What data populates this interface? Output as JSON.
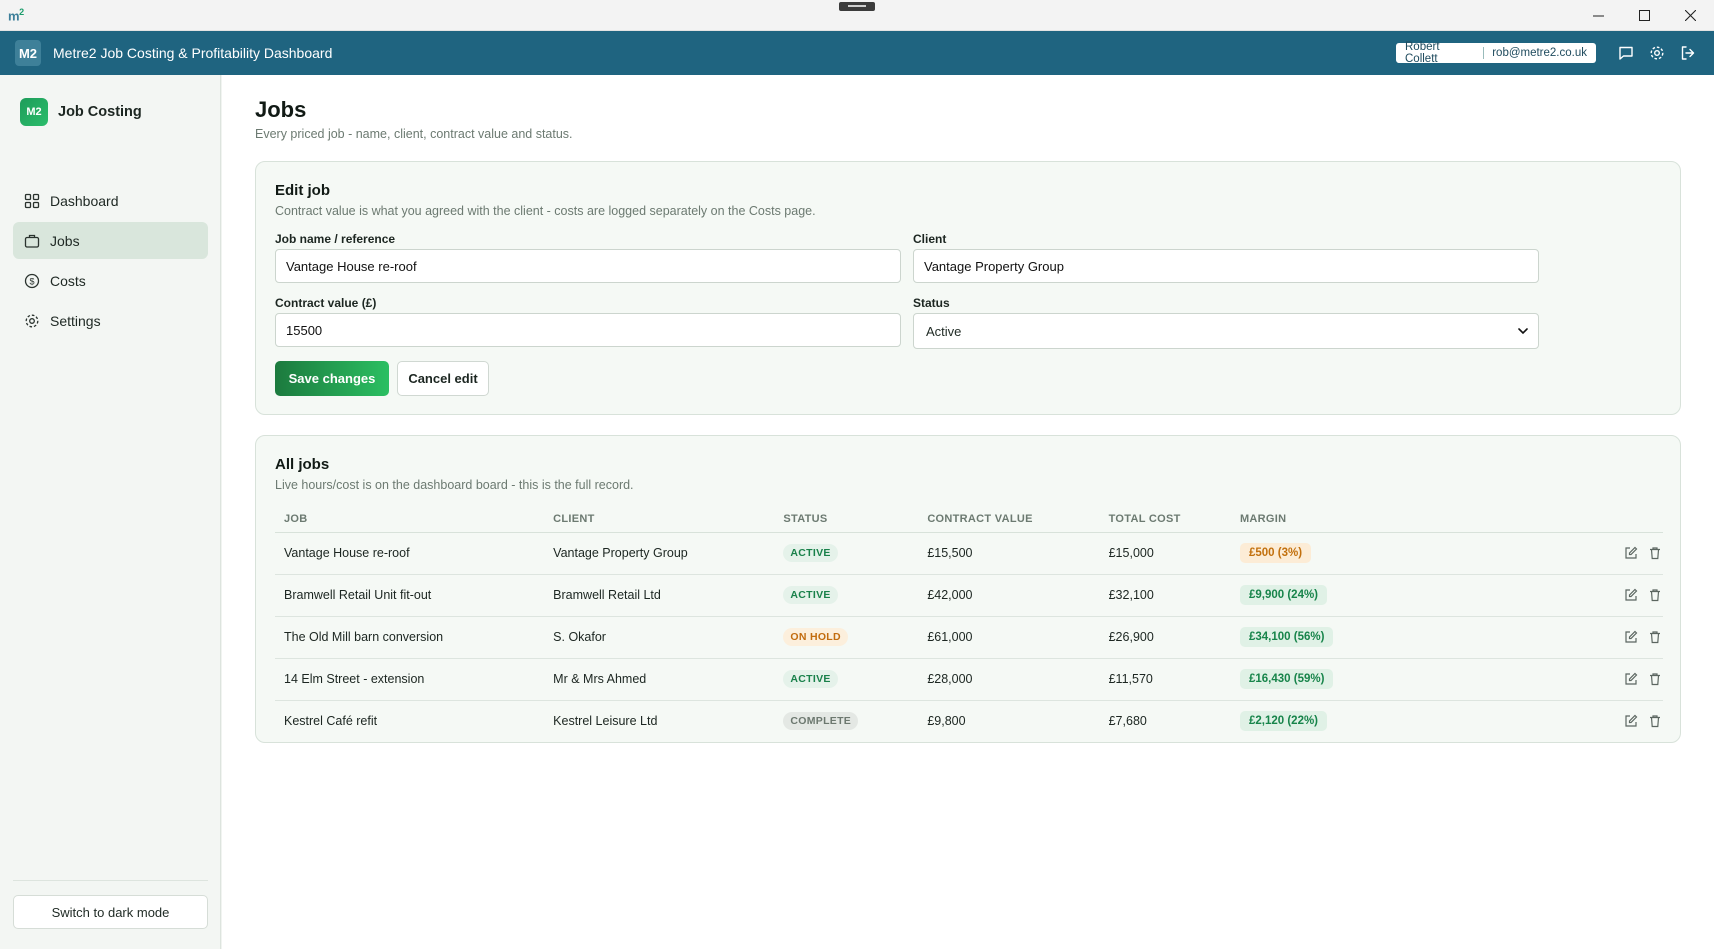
{
  "os": {
    "logo": "m",
    "logo_sup": "2"
  },
  "header": {
    "badge": "M2",
    "title": "Metre2 Job Costing & Profitability Dashboard",
    "user_name": "Robert Collett",
    "user_email": "rob@metre2.co.uk"
  },
  "sidebar": {
    "brand_badge": "M2",
    "brand_name": "Job Costing",
    "items": [
      {
        "label": "Dashboard",
        "icon": "grid-icon"
      },
      {
        "label": "Jobs",
        "icon": "briefcase-icon",
        "active": true
      },
      {
        "label": "Costs",
        "icon": "dollar-icon"
      },
      {
        "label": "Settings",
        "icon": "gear-icon"
      }
    ],
    "dark_mode_label": "Switch to dark mode"
  },
  "page": {
    "title": "Jobs",
    "subtitle": "Every priced job - name, client, contract value and status."
  },
  "edit": {
    "title": "Edit job",
    "subtitle": "Contract value is what you agreed with the client - costs are logged separately on the Costs page.",
    "job_label": "Job name / reference",
    "job_value": "Vantage House re-roof",
    "client_label": "Client",
    "client_value": "Vantage Property Group",
    "contract_label": "Contract value (£)",
    "contract_value": "15500",
    "status_label": "Status",
    "status_value": "Active",
    "save_label": "Save changes",
    "cancel_label": "Cancel edit"
  },
  "jobs": {
    "title": "All jobs",
    "subtitle": "Live hours/cost is on the dashboard board - this is the full record.",
    "columns": [
      "JOB",
      "CLIENT",
      "STATUS",
      "CONTRACT VALUE",
      "TOTAL COST",
      "MARGIN"
    ],
    "rows": [
      {
        "job": "Vantage House re-roof",
        "client": "Vantage Property Group",
        "status": "ACTIVE",
        "contract": "£15,500",
        "cost": "£15,000",
        "margin": "£500 (3%)"
      },
      {
        "job": "Bramwell Retail Unit fit-out",
        "client": "Bramwell Retail Ltd",
        "status": "ACTIVE",
        "contract": "£42,000",
        "cost": "£32,100",
        "margin": "£9,900 (24%)"
      },
      {
        "job": "The Old Mill barn conversion",
        "client": "S. Okafor",
        "status": "ON HOLD",
        "contract": "£61,000",
        "cost": "£26,900",
        "margin": "£34,100 (56%)"
      },
      {
        "job": "14 Elm Street - extension",
        "client": "Mr & Mrs Ahmed",
        "status": "ACTIVE",
        "contract": "£28,000",
        "cost": "£11,570",
        "margin": "£16,430 (59%)"
      },
      {
        "job": "Kestrel Café refit",
        "client": "Kestrel Leisure Ltd",
        "status": "COMPLETE",
        "contract": "£9,800",
        "cost": "£7,680",
        "margin": "£2,120 (22%)"
      }
    ]
  },
  "colors": {
    "header_bg": "#1f6480",
    "accent_green": "#1c7a3e",
    "active_status": "#19814a",
    "hold_status": "#c26c0f"
  }
}
